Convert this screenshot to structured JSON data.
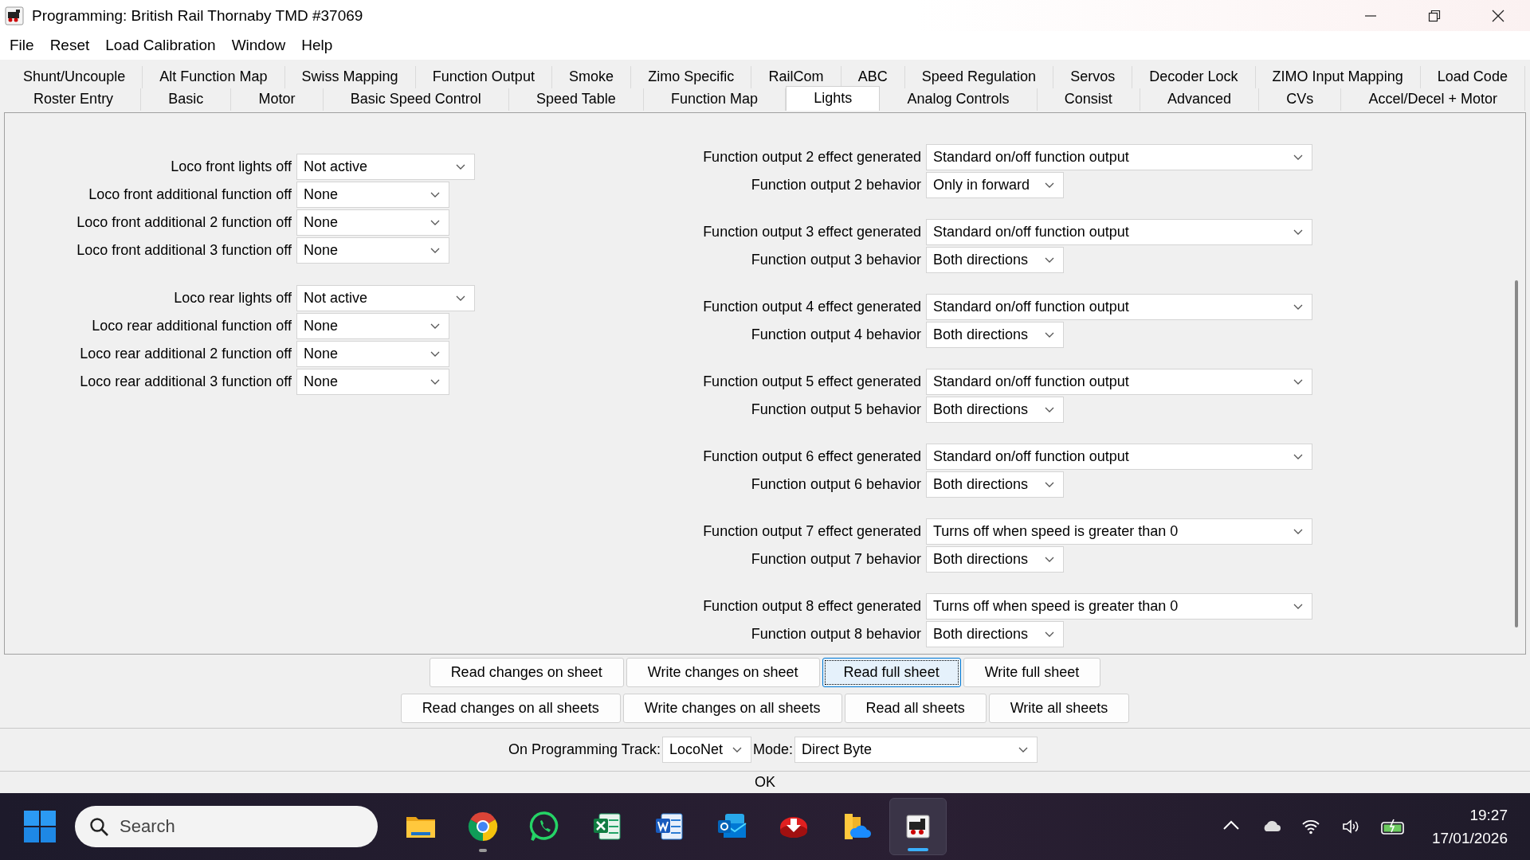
{
  "window": {
    "title": "Programming: British Rail Thornaby TMD #37069"
  },
  "menu": [
    "File",
    "Reset",
    "Load Calibration",
    "Window",
    "Help"
  ],
  "tabs": [
    [
      {
        "label": "Shunt/Uncouple",
        "selected": false
      },
      {
        "label": "Alt Function Map",
        "selected": false
      },
      {
        "label": "Swiss Mapping",
        "selected": false
      },
      {
        "label": "Function Output",
        "selected": false
      },
      {
        "label": "Smoke",
        "selected": false
      },
      {
        "label": "Zimo Specific",
        "selected": false
      },
      {
        "label": "RailCom",
        "selected": false
      },
      {
        "label": "ABC",
        "selected": false
      },
      {
        "label": "Speed Regulation",
        "selected": false
      },
      {
        "label": "Servos",
        "selected": false
      },
      {
        "label": "Decoder Lock",
        "selected": false
      },
      {
        "label": "ZIMO Input Mapping",
        "selected": false
      },
      {
        "label": "Load Code",
        "selected": false
      }
    ],
    [
      {
        "label": "Roster Entry",
        "selected": false
      },
      {
        "label": "Basic",
        "selected": false
      },
      {
        "label": "Motor",
        "selected": false
      },
      {
        "label": "Basic Speed Control",
        "selected": false
      },
      {
        "label": "Speed Table",
        "selected": false
      },
      {
        "label": "Function Map",
        "selected": false
      },
      {
        "label": "Lights",
        "selected": true
      },
      {
        "label": "Analog Controls",
        "selected": false
      },
      {
        "label": "Consist",
        "selected": false
      },
      {
        "label": "Advanced",
        "selected": false
      },
      {
        "label": "CVs",
        "selected": false
      },
      {
        "label": "Accel/Decel + Motor",
        "selected": false
      }
    ]
  ],
  "left_groups": [
    [
      {
        "label": "Loco front lights off",
        "value": "Not active"
      },
      {
        "label": "Loco front additional function off",
        "value": "None"
      },
      {
        "label": "Loco front additional 2 function off",
        "value": "None"
      },
      {
        "label": "Loco front additional 3 function off",
        "value": "None"
      }
    ],
    [
      {
        "label": "Loco rear lights off",
        "value": "Not active"
      },
      {
        "label": "Loco rear additional function off",
        "value": "None"
      },
      {
        "label": "Loco rear additional 2 function off",
        "value": "None"
      },
      {
        "label": "Loco rear additional 3 function off",
        "value": "None"
      }
    ]
  ],
  "outputs": [
    {
      "effect_label": "Function output 2 effect generated",
      "effect": "Standard on/off function output",
      "behavior_label": "Function output 2 behavior",
      "behavior": "Only in forward"
    },
    {
      "effect_label": "Function output 3 effect generated",
      "effect": "Standard on/off function output",
      "behavior_label": "Function output 3 behavior",
      "behavior": "Both directions"
    },
    {
      "effect_label": "Function output 4 effect generated",
      "effect": "Standard on/off function output",
      "behavior_label": "Function output 4 behavior",
      "behavior": "Both directions"
    },
    {
      "effect_label": "Function output 5 effect generated",
      "effect": "Standard on/off function output",
      "behavior_label": "Function output 5 behavior",
      "behavior": "Both directions"
    },
    {
      "effect_label": "Function output 6 effect generated",
      "effect": "Standard on/off function output",
      "behavior_label": "Function output 6 behavior",
      "behavior": "Both directions"
    },
    {
      "effect_label": "Function output 7 effect generated",
      "effect": "Turns off when speed is greater than 0",
      "behavior_label": "Function output 7 behavior",
      "behavior": "Both directions"
    },
    {
      "effect_label": "Function output 8 effect generated",
      "effect": "Turns off when speed is greater than 0",
      "behavior_label": "Function output 8 behavior",
      "behavior": "Both directions"
    }
  ],
  "buttons": [
    [
      {
        "label": "Read changes on sheet",
        "focused": false
      },
      {
        "label": "Write changes on sheet",
        "focused": false
      },
      {
        "label": "Read full sheet",
        "focused": true
      },
      {
        "label": "Write full sheet",
        "focused": false
      }
    ],
    [
      {
        "label": "Read changes on all sheets",
        "focused": false
      },
      {
        "label": "Write changes on all sheets",
        "focused": false
      },
      {
        "label": "Read all sheets",
        "focused": false
      },
      {
        "label": "Write all sheets",
        "focused": false
      }
    ]
  ],
  "programming": {
    "track_label": "On Programming Track:",
    "track": "LocoNet",
    "mode_label": "Mode:",
    "mode": "Direct Byte"
  },
  "status": "OK",
  "taskbar": {
    "search": {
      "placeholder": "Search"
    },
    "apps": [
      {
        "kind": "folder",
        "running": false,
        "selected": false
      },
      {
        "kind": "browser",
        "running": true,
        "selected": false
      },
      {
        "kind": "chat",
        "running": false,
        "selected": false
      },
      {
        "kind": "spreadsheet",
        "running": false,
        "selected": false
      },
      {
        "kind": "document",
        "running": false,
        "selected": false
      },
      {
        "kind": "mail",
        "running": false,
        "selected": false
      },
      {
        "kind": "download",
        "running": false,
        "selected": false
      },
      {
        "kind": "cloud-folder",
        "running": false,
        "selected": false
      },
      {
        "kind": "locomotive",
        "running": true,
        "selected": true
      }
    ],
    "time": "19:27",
    "date": "17/01/2026"
  }
}
